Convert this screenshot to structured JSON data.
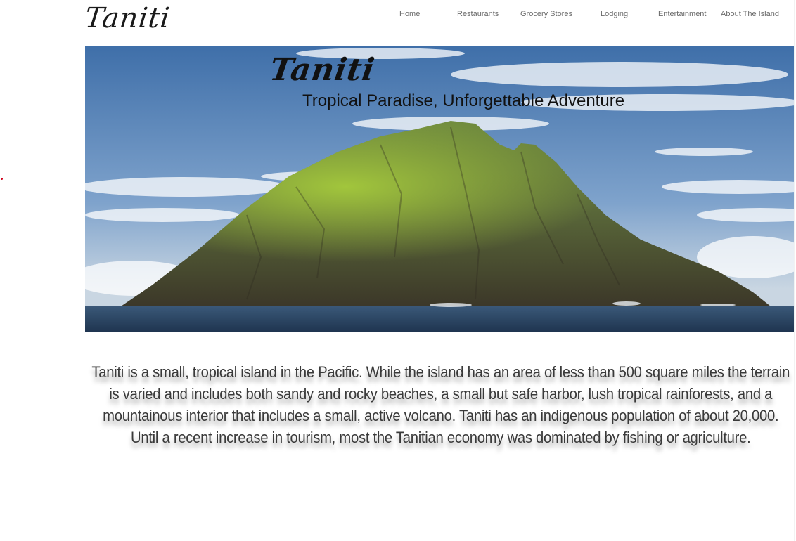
{
  "header": {
    "logo_text": "Taniti",
    "nav": [
      {
        "label": "Home"
      },
      {
        "label": "Restaurants"
      },
      {
        "label": "Grocery Stores"
      },
      {
        "label": "Lodging"
      },
      {
        "label": "Entertainment"
      },
      {
        "label": "About The Island"
      }
    ]
  },
  "hero": {
    "logo_text": "Taniti",
    "tagline": "Tropical Paradise, Unforgettable Adventure",
    "image_subject": "rocky-island-photo"
  },
  "main": {
    "intro": "Taniti is a small, tropical island in the Pacific. While the island has an area of less than 500 square miles the terrain is varied and includes both sandy and rocky beaches, a small but safe harbor, lush tropical rainforests, and a mountainous interior that includes a small, active volcano. Taniti has an indigenous population of about 20,000. Until a recent increase in tourism, most the Tanitian economy was dominated by fishing or agriculture."
  },
  "colors": {
    "nav_text": "#6b6b6b",
    "body_text": "#3a3a3a",
    "sky": "#4f7fb8",
    "sea": "#2e4a6a"
  }
}
